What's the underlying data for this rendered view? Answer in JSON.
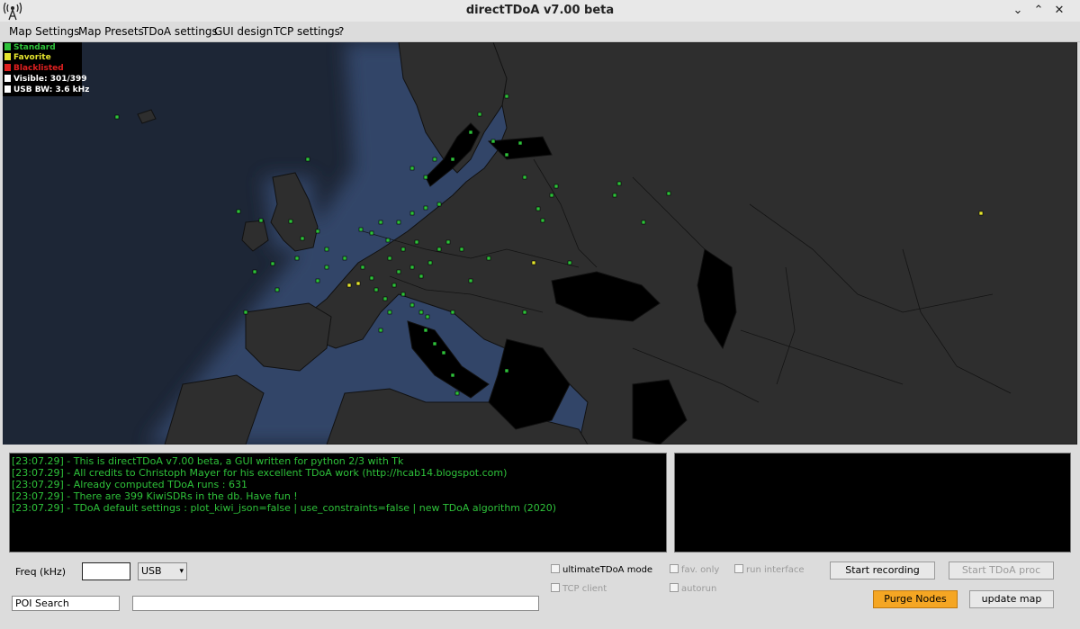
{
  "window": {
    "title": "directTDoA v7.00 beta",
    "icon": "antenna-icon",
    "buttons": {
      "minimize": "⌄",
      "maximize": "⌃",
      "close": "✕"
    }
  },
  "menu": [
    "Map Settings",
    "Map Presets",
    "TDoA settings",
    "GUI design",
    "TCP settings",
    "?"
  ],
  "legend": {
    "standard": "Standard",
    "favorite": "Favorite",
    "blacklisted": "Blacklisted",
    "visible": "Visible: 301/399",
    "usb_bw": "USB BW: 3.6 kHz",
    "colors": {
      "standard": "#2ec23a",
      "favorite": "#e6e62e",
      "blacklisted": "#e02020",
      "info": "#ffffff"
    }
  },
  "console": [
    "[23:07.29] - This is directTDoA v7.00 beta, a GUI written for python 2/3 with Tk",
    "[23:07.29] - All credits to Christoph Mayer for his excellent TDoA work (http://hcab14.blogspot.com)",
    "[23:07.29] - Already computed TDoA runs : 631",
    "[23:07.29] - There are 399 KiwiSDRs in the db. Have fun !",
    "[23:07.29] - TDoA default settings : plot_kiwi_json=false | use_constraints=false | new TDoA algorithm (2020)"
  ],
  "controls": {
    "freq_label": "Freq (kHz)",
    "freq_value": "",
    "mode_value": "USB",
    "poi_search": "POI Search",
    "poi_value": "",
    "ultimate_tdoa": "ultimateTDoA mode",
    "tcp_client": "TCP client",
    "fav_only": "fav. only",
    "autorun": "autorun",
    "run_interface": "run interface",
    "start_recording": "Start recording",
    "start_tdoa": "Start TDoA proc",
    "purge_nodes": "Purge Nodes",
    "update_map": "update map"
  },
  "colors": {
    "accent_orange": "#f5a623",
    "console_text": "#2ec23a",
    "sea": "#1f2a40",
    "land": "#2e2e2e"
  }
}
